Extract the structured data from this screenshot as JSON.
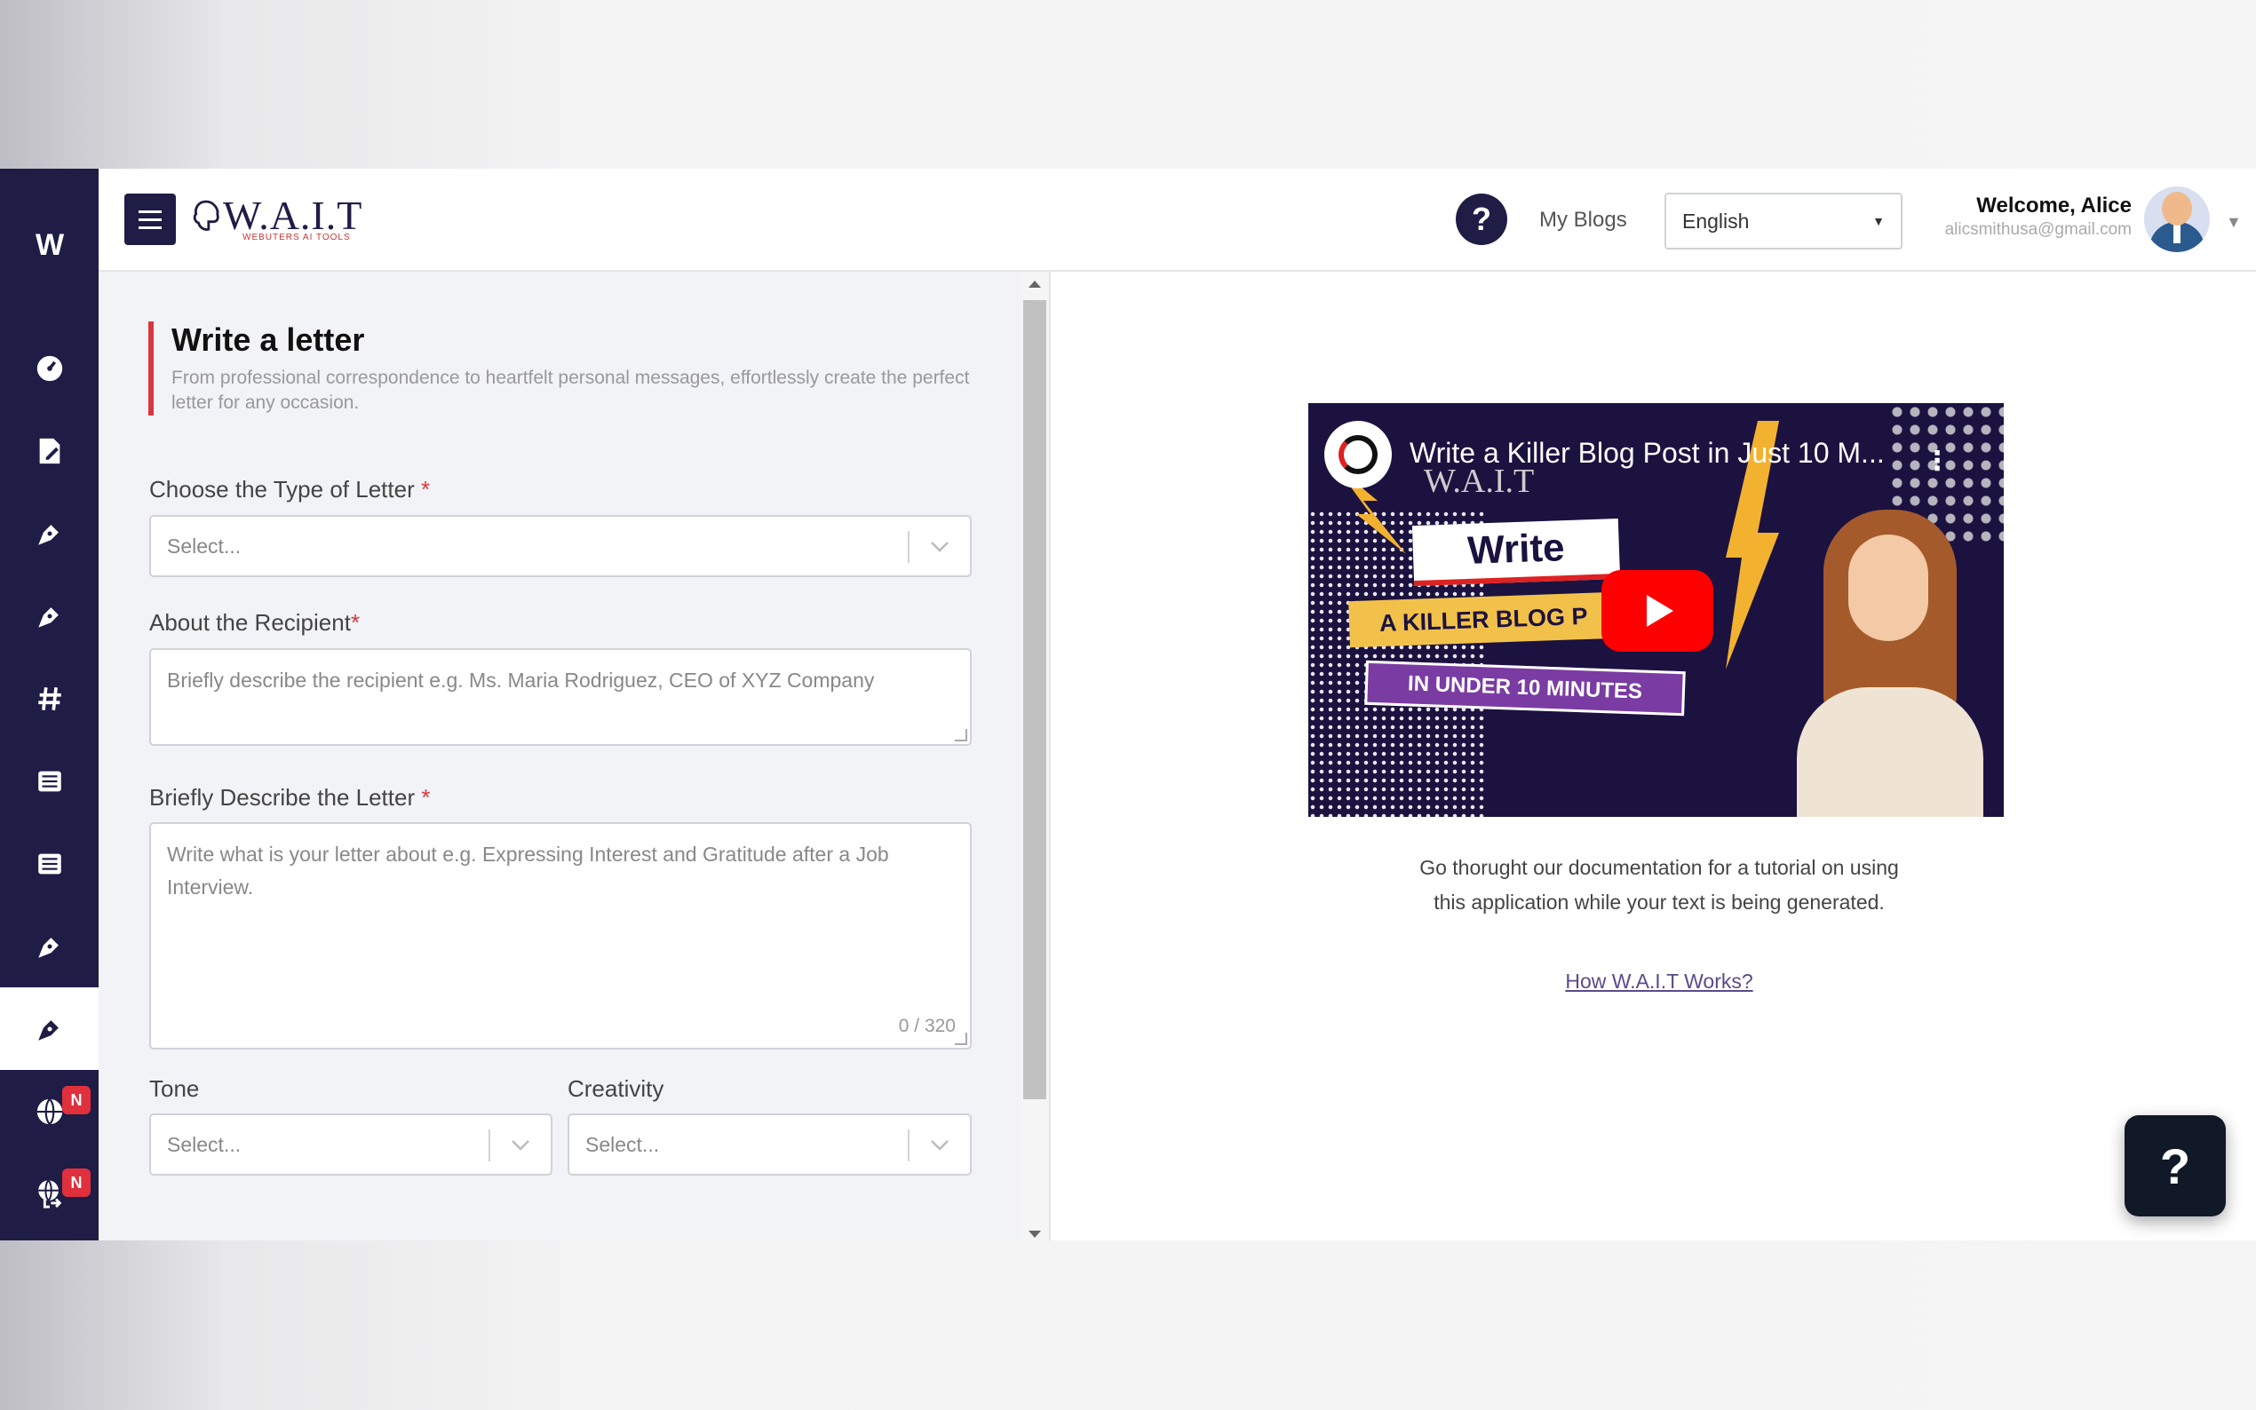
{
  "brand": {
    "name": "W.A.I.T",
    "subtitle": "WEBUTERS AI TOOLS",
    "sidebar_mark": "W"
  },
  "header": {
    "help_symbol": "?",
    "my_blogs": "My Blogs",
    "language": "English",
    "welcome": "Welcome, Alice",
    "email": "alicsmithusa@gmail.com"
  },
  "sidebar": {
    "items": [
      {
        "icon": "dashboard-icon"
      },
      {
        "icon": "document-edit-icon"
      },
      {
        "icon": "pen-icon"
      },
      {
        "icon": "pen-icon"
      },
      {
        "icon": "hashtag-icon"
      },
      {
        "icon": "newspaper-icon"
      },
      {
        "icon": "newspaper-icon"
      },
      {
        "icon": "pen-icon"
      },
      {
        "icon": "pen-icon",
        "active": true
      },
      {
        "icon": "globe-icon",
        "badge": "N"
      },
      {
        "icon": "globe-export-icon",
        "badge": "N"
      }
    ]
  },
  "form": {
    "title": "Write a letter",
    "description": "From professional correspondence to heartfelt personal messages, effortlessly create the perfect letter for any occasion.",
    "type_label": "Choose the Type of Letter ",
    "type_placeholder": "Select...",
    "recipient_label": "About the Recipient",
    "recipient_placeholder": "Briefly describe the recipient e.g. Ms. Maria Rodriguez, CEO of XYZ Company",
    "describe_label": "Briefly Describe the Letter ",
    "describe_placeholder": "Write what is your letter about e.g. Expressing Interest and Gratitude after a Job Interview.",
    "describe_counter": "0 / 320",
    "tone_label": "Tone",
    "tone_placeholder": "Select...",
    "creativity_label": "Creativity",
    "creativity_placeholder": "Select...",
    "required_mark": "*"
  },
  "video": {
    "title": "Write a Killer Blog Post in Just 10 M...",
    "brand_overlay": "W.A.I.T",
    "thumb_write": "Write",
    "thumb_killer": "A KILLER BLOG P",
    "thumb_under": "IN UNDER 10 MINUTES"
  },
  "docs": {
    "text": "Go thorught our documentation for a tutorial on using this application while your text is being generated.",
    "link": "How W.A.I.T Works?"
  },
  "float_help": "?",
  "colors": {
    "sidebar": "#1f1c46",
    "accent_red": "#d9363e",
    "play_red": "#ff0000"
  }
}
